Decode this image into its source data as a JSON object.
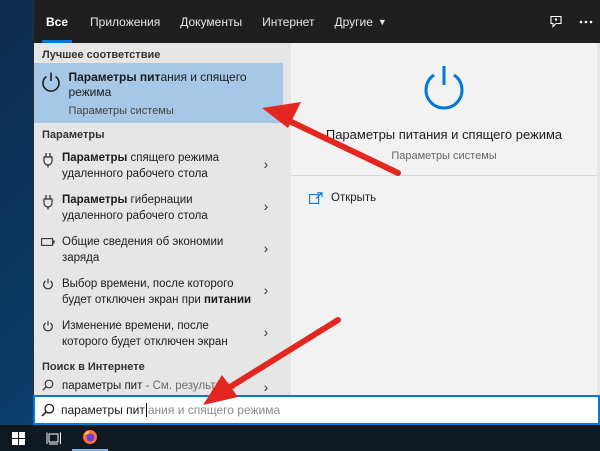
{
  "tabs": [
    {
      "label": "Все"
    },
    {
      "label": "Приложения"
    },
    {
      "label": "Документы"
    },
    {
      "label": "Интернет"
    },
    {
      "label": "Другие"
    }
  ],
  "sections": {
    "best": "Лучшее соответствие",
    "settings": "Параметры",
    "web": "Поиск в Интернете"
  },
  "best_match": {
    "title_bold": "Параметры пит",
    "title_rest": "ания и спящего режима",
    "subtitle": "Параметры системы"
  },
  "settings_items": [
    {
      "icon": "power-plug-icon",
      "bold": "Параметры",
      "rest": " спящего режима удаленного рабочего стола"
    },
    {
      "icon": "power-plug-icon",
      "bold": "Параметры",
      "rest": " гибернации удаленного рабочего стола"
    },
    {
      "icon": "battery-icon",
      "pre": "Общие сведения об экономии заряда"
    },
    {
      "icon": "power-icon",
      "pre": "Выбор времени, после которого будет отключен экран при ",
      "bold": "питании"
    },
    {
      "icon": "power-icon",
      "pre": "Изменение времени, после которого будет отключен экран"
    }
  ],
  "web_item": {
    "query": "параметры пит",
    "suffix": " - См. результаты"
  },
  "preview": {
    "title": "Параметры питания и спящего режима",
    "subtitle": "Параметры системы",
    "open_label": "Открыть"
  },
  "search": {
    "typed": "параметры пит",
    "ghost": "ания и спящего режима"
  },
  "colors": {
    "accent": "#0078d7",
    "selected_bg": "#a6c8e6",
    "annotation_arrow": "#e3261f"
  }
}
